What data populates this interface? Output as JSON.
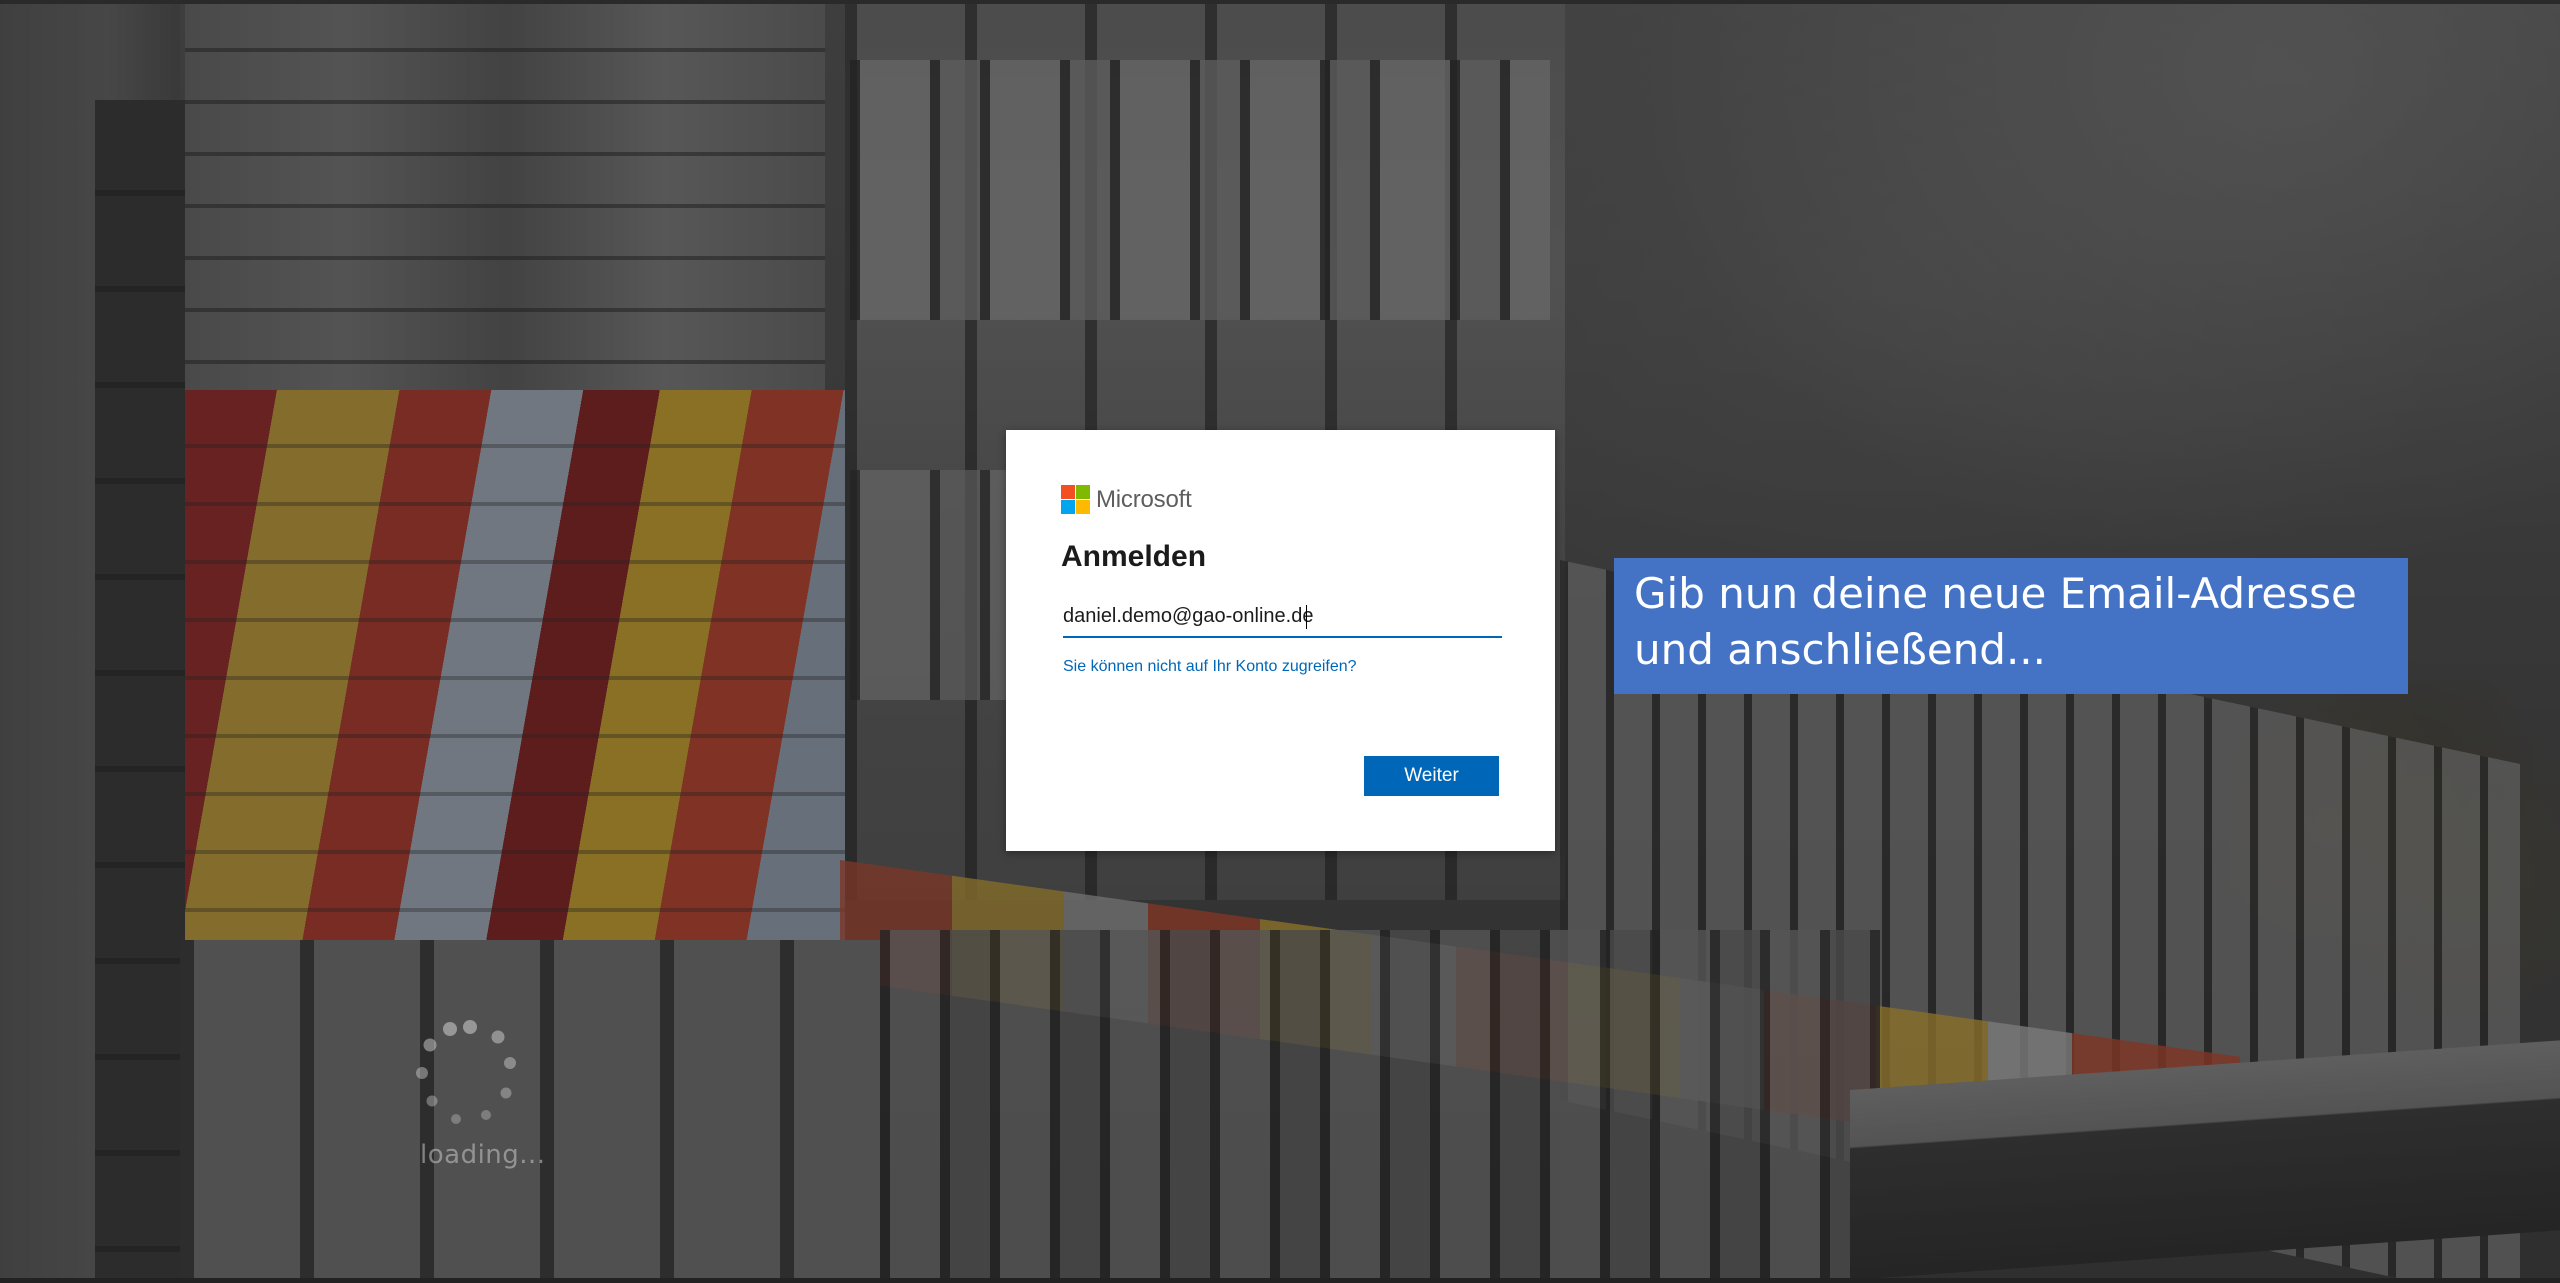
{
  "background": {
    "loading_text": "loading..."
  },
  "dialog": {
    "brand_name": "Microsoft",
    "title": "Anmelden",
    "email_value": "daniel.demo@gao-online.de",
    "help_link": "Sie können nicht auf Ihr Konto zugreifen?",
    "next_label": "Weiter",
    "accent_color": "#0067b8",
    "logo_colors": [
      "#f25022",
      "#7fba00",
      "#00a4ef",
      "#ffb900"
    ]
  },
  "callout": {
    "line1": "Gib nun deine neue Email-Adresse",
    "line2": "und anschließend...",
    "background_color": "#4472c4"
  }
}
